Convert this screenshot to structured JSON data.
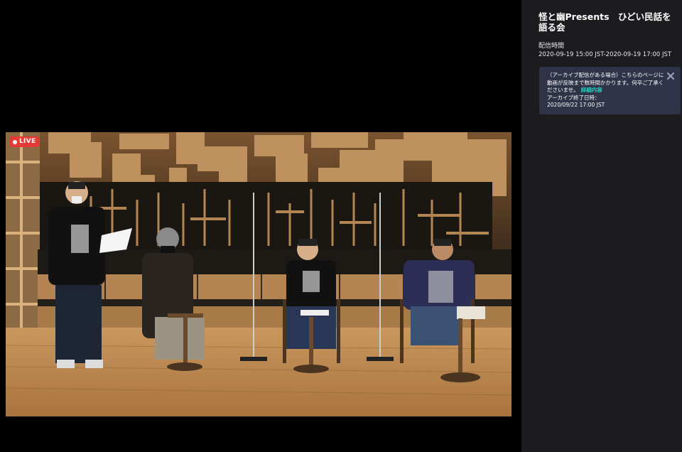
{
  "player": {
    "live_badge": "LIVE"
  },
  "event": {
    "title": "怪と幽Presents　ひどい民話を語る会",
    "schedule_label": "配信時間",
    "schedule_value": "2020-09-19 15:00 JST-2020-09-19 17:00 JST"
  },
  "notice": {
    "text": "（アーカイブ配信がある場合）こちらのページに動画が反映まで数時間かかります。何卒ご了承くださいませ。",
    "link_label": "詳細内容",
    "archive_label": "アーカイブ終了日時：",
    "archive_value": "2020/09/22 17:00 JST"
  },
  "colors": {
    "live_red": "#e53935",
    "sidebar_bg": "#1c1c1f",
    "notice_bg": "#2e3347",
    "link_teal": "#29d3c4"
  },
  "icons": {
    "close": "close-icon",
    "live_indicator": "live-dot-icon"
  }
}
